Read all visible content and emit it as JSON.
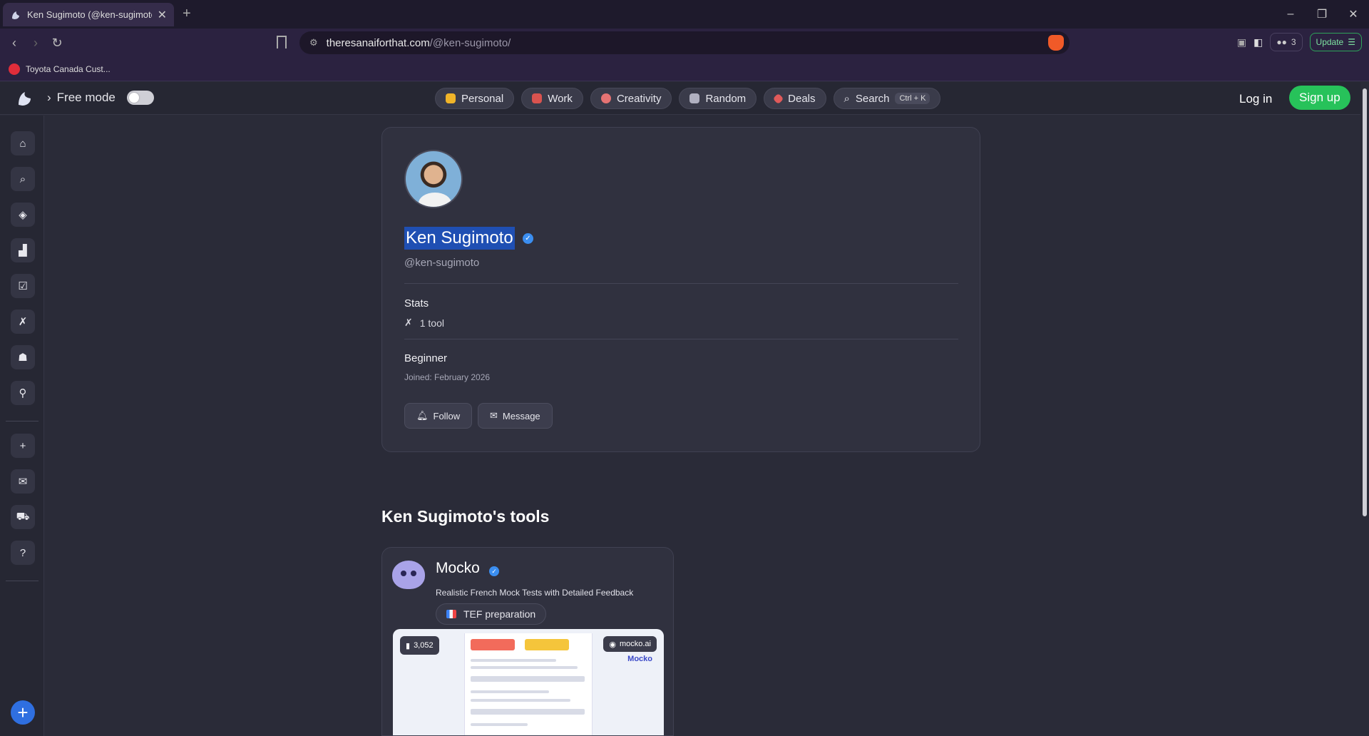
{
  "browser": {
    "tab_title": "Ken Sugimoto (@ken-sugimoto)",
    "url_host": "theresanaiforthat.com",
    "url_path": "/@ken-sugimoto/",
    "shield_count": "3",
    "update_label": "Update",
    "bookmark": "Toyota Canada Cust..."
  },
  "header": {
    "free_mode_label": "Free mode",
    "categories": [
      {
        "label": "Personal",
        "color": "#f0b429"
      },
      {
        "label": "Work",
        "color": "#d9534f"
      },
      {
        "label": "Creativity",
        "color": "#e57373"
      },
      {
        "label": "Random",
        "color": "#b0b0c0"
      },
      {
        "label": "Deals",
        "color": "#e05a5a"
      }
    ],
    "search_label": "Search",
    "search_shortcut": "Ctrl + K",
    "login_label": "Log in",
    "signup_label": "Sign up"
  },
  "profile": {
    "name": "Ken Sugimoto",
    "handle": "@ken-sugimoto",
    "stats_label": "Stats",
    "tools_count": "1 tool",
    "level": "Beginner",
    "joined": "Joined: February 2026",
    "follow_label": "Follow",
    "message_label": "Message"
  },
  "tools_section": {
    "title": "Ken Sugimoto's tools",
    "tool": {
      "name": "Mocko",
      "description": "Realistic French Mock Tests with Detailed Feedback",
      "tag": "TEF preparation",
      "views": "3,052",
      "brand_badge": "mocko.ai",
      "brand_mini": "Mocko"
    }
  },
  "colors": {
    "accent_green": "#27c25a",
    "verified_blue": "#3b8ef0",
    "selection": "#1f4fb3"
  }
}
